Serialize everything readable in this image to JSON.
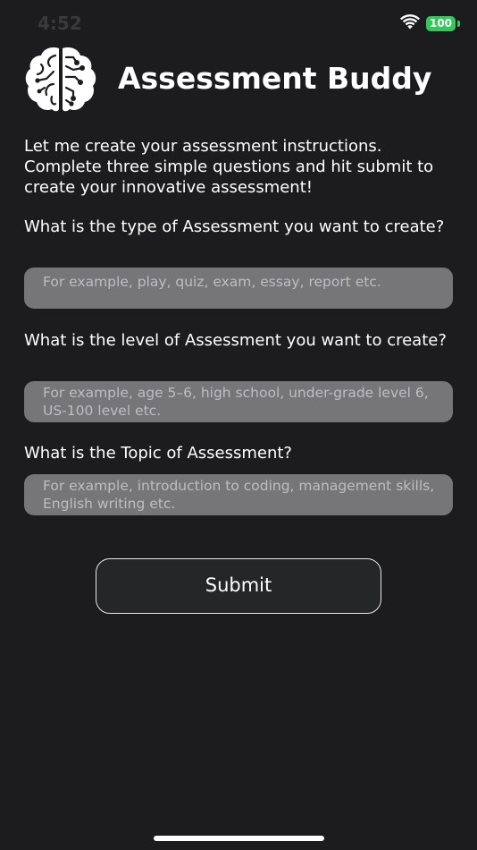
{
  "status_bar": {
    "time": "4:52",
    "carrier": "",
    "battery_level": "100",
    "battery_color": "#34c759"
  },
  "header": {
    "title": "Assessment Buddy",
    "logo_icon": "brain-circuit-icon"
  },
  "intro": {
    "text": "Let me create your assessment instructions. Complete three simple questions and hit submit to create your innovative assessment!"
  },
  "questions": [
    {
      "label": "What is the type of Assessment you want to create?",
      "placeholder": "For example, play, quiz, exam, essay, report etc.",
      "value": ""
    },
    {
      "label": "What is the level of Assessment you want to create?",
      "placeholder": "For example, age 5–6, high school, under-grade level 6, US-100 level etc.",
      "value": ""
    },
    {
      "label": "What is the Topic of Assessment?",
      "placeholder": "For example, introduction to coding, management skills, English writing etc.",
      "value": ""
    }
  ],
  "submit": {
    "label": "Submit"
  },
  "colors": {
    "background": "#1c1c1e",
    "field": "#767679",
    "button_border": "#e8e8ea"
  }
}
